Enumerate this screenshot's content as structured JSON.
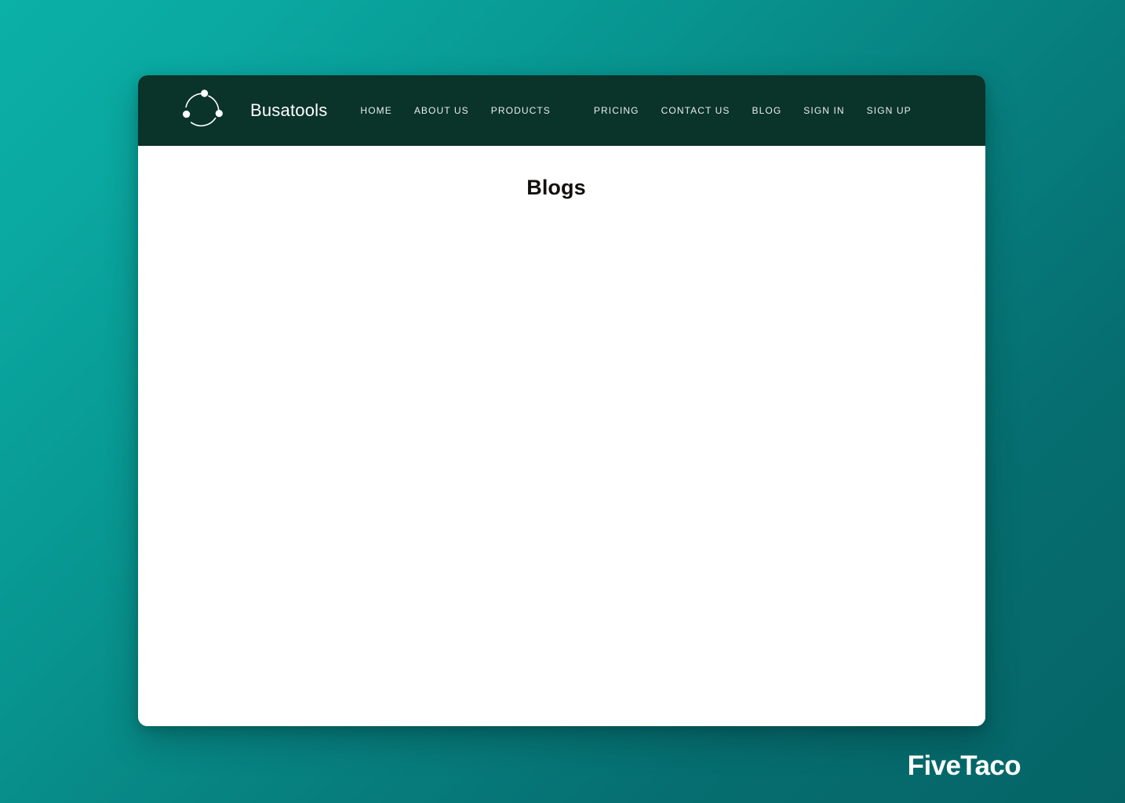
{
  "background": {
    "gradient_from": "#0bb0a6",
    "gradient_to": "#056466"
  },
  "card": {
    "header_color": "#0a3329",
    "body_color": "#ffffff"
  },
  "header": {
    "logo_icon": "three-arc-circle-logo-icon",
    "brand_name": "Busatools",
    "nav": [
      {
        "label": "HOME",
        "name": "nav-link-home"
      },
      {
        "label": "ABOUT US",
        "name": "nav-link-about-us"
      },
      {
        "label": "PRODUCTS",
        "name": "nav-link-products"
      },
      {
        "label": "PRICING",
        "name": "nav-link-pricing"
      },
      {
        "label": "CONTACT US",
        "name": "nav-link-contact-us"
      },
      {
        "label": "BLOG",
        "name": "nav-link-blog"
      },
      {
        "label": "SIGN IN",
        "name": "nav-link-sign-in"
      },
      {
        "label": "SIGN UP",
        "name": "nav-link-sign-up"
      }
    ]
  },
  "main": {
    "page_title": "Blogs"
  },
  "watermark": {
    "text": "FiveTaco"
  }
}
